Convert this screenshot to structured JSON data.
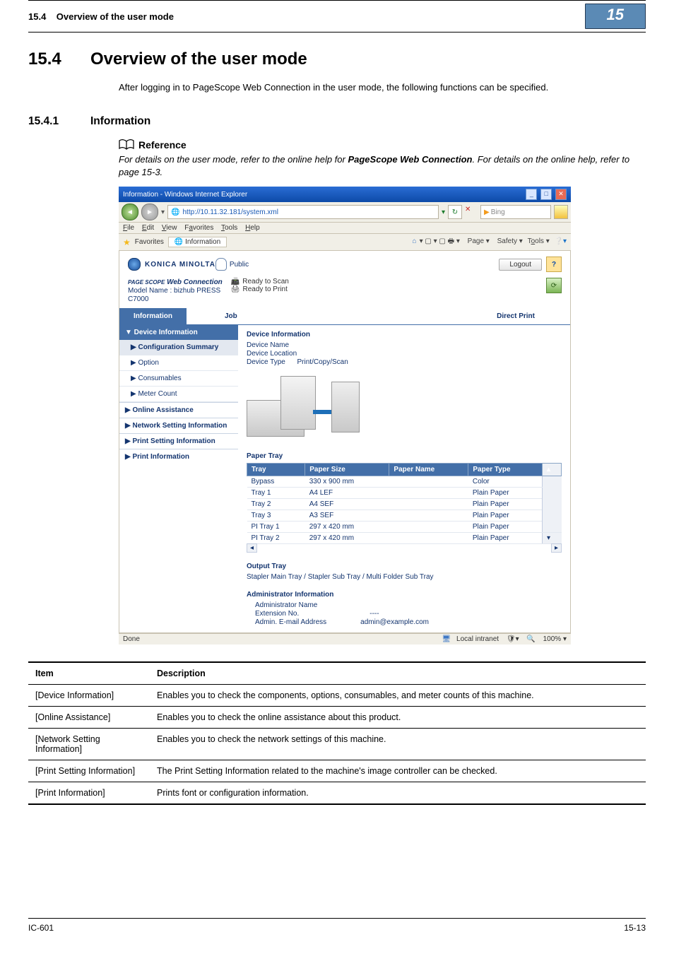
{
  "header": {
    "section": "15.4",
    "title": "Overview of the user mode",
    "chapter_badge": "15"
  },
  "heading": {
    "num": "15.4",
    "text": "Overview of the user mode"
  },
  "intro": "After logging in to PageScope Web Connection in the user mode, the following functions can be specified.",
  "sub": {
    "num": "15.4.1",
    "text": "Information"
  },
  "reference": {
    "label": "Reference",
    "text_pre": "For details on the user mode, refer to the online help for ",
    "bold": "PageScope  Web Connection",
    "text_post": ". For details on the online help, refer to page 15-3."
  },
  "screenshot": {
    "titlebar": "Information - Windows Internet Explorer",
    "url": "http://10.11.32.181/system.xml",
    "search_engine": "Bing",
    "menus": [
      "File",
      "Edit",
      "View",
      "Favorites",
      "Tools",
      "Help"
    ],
    "menus_ul": [
      "F",
      "E",
      "V",
      "a",
      "T",
      "H"
    ],
    "fav_label": "Favorites",
    "fav_tab": "Information",
    "toolbar_items": [
      "Page",
      "Safety",
      "Tools"
    ],
    "brand": "KONICA MINOLTA",
    "public": "Public",
    "logout": "Logout",
    "q": "?",
    "webconn_pre": "PAGE SCOPE",
    "webconn": "Web Connection",
    "model_label": "Model Name : bizhub PRESS",
    "model2": "C7000",
    "ready_scan": "Ready to Scan",
    "ready_print": "Ready to Print",
    "tabs": {
      "info": "Information",
      "job": "Job",
      "direct": "Direct Print"
    },
    "side_group": "▼ Device Information",
    "side_items": [
      "Configuration Summary",
      "Option",
      "Consumables",
      "Meter Count"
    ],
    "side_items2": [
      "Online Assistance",
      "Network Setting Information",
      "Print Setting Information",
      "Print Information"
    ],
    "panel_title": "Device Information",
    "kv": {
      "dn": "Device Name",
      "dl": "Device Location",
      "dt": "Device Type",
      "dtv": "Print/Copy/Scan"
    },
    "paper_tray": {
      "title": "Paper Tray",
      "cols": [
        "Tray",
        "Paper Size",
        "Paper Name",
        "Paper Type"
      ],
      "rows": [
        {
          "t": "Bypass",
          "s": "330 x 900 mm",
          "n": "",
          "p": "Color"
        },
        {
          "t": "Tray 1",
          "s": "A4 LEF",
          "n": "",
          "p": "Plain Paper"
        },
        {
          "t": "Tray 2",
          "s": "A4 SEF",
          "n": "",
          "p": "Plain Paper"
        },
        {
          "t": "Tray 3",
          "s": "A3 SEF",
          "n": "",
          "p": "Plain Paper"
        },
        {
          "t": "PI Tray 1",
          "s": "297 x 420 mm",
          "n": "",
          "p": "Plain Paper"
        },
        {
          "t": "PI Tray 2",
          "s": "297 x 420 mm",
          "n": "",
          "p": "Plain Paper"
        }
      ]
    },
    "output_tray": {
      "title": "Output Tray",
      "line": "Stapler Main Tray / Stapler Sub Tray / Multi Folder Sub Tray"
    },
    "admin": {
      "title": "Administrator Information",
      "name": "Administrator Name",
      "ext": "Extension No.",
      "ext_v": "----",
      "mail": "Admin. E-mail Address",
      "mail_v": "admin@example.com"
    },
    "status": {
      "done": "Done",
      "zone": "Local intranet",
      "zoom": "100%"
    }
  },
  "table": {
    "head": {
      "item": "Item",
      "desc": "Description"
    },
    "rows": [
      {
        "item": "[Device Information]",
        "desc": "Enables you to check the components, options, consumables, and meter counts of this machine."
      },
      {
        "item": "[Online Assistance]",
        "desc": "Enables you to check the online assistance about this product."
      },
      {
        "item": "[Network Setting Information]",
        "desc": "Enables you to check the network settings of this machine."
      },
      {
        "item": "[Print Setting Information]",
        "desc": "The Print Setting Information related to the machine's image controller can be checked."
      },
      {
        "item": "[Print Information]",
        "desc": "Prints font or configuration information."
      }
    ]
  },
  "footer": {
    "left": "IC-601",
    "right": "15-13"
  }
}
